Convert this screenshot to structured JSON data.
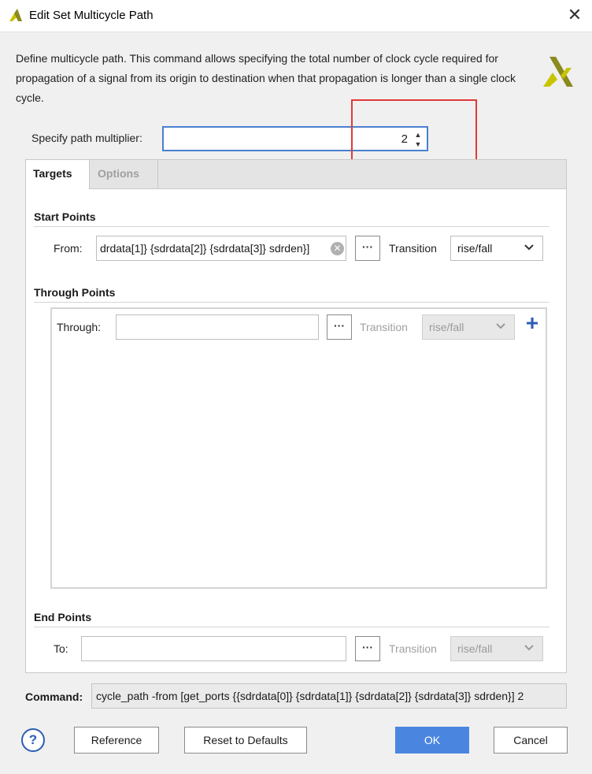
{
  "window": {
    "title": "Edit Set Multicycle Path",
    "close_glyph": "✕"
  },
  "description": "Define multicycle path. This command allows specifying the total number of clock cycle required for propagation of a signal from its origin to destination when that propagation is longer than a single clock cycle.",
  "multiplier": {
    "label": "Specify path multiplier:",
    "value": "2"
  },
  "tabs": [
    {
      "label": "Targets",
      "active": true
    },
    {
      "label": "Options",
      "active": false
    }
  ],
  "start_points": {
    "heading": "Start Points",
    "from_label": "From:",
    "from_value": "drdata[1]} {sdrdata[2]} {sdrdata[3]} sdrden}]",
    "browse_label": "···",
    "transition_label": "Transition",
    "transition_value": "rise/fall"
  },
  "through_points": {
    "heading": "Through Points",
    "through_label": "Through:",
    "through_value": "",
    "browse_label": "···",
    "transition_label": "Transition",
    "transition_value": "rise/fall",
    "add_glyph": "+"
  },
  "end_points": {
    "heading": "End Points",
    "to_label": "To:",
    "to_value": "",
    "browse_label": "···",
    "transition_label": "Transition",
    "transition_value": "rise/fall"
  },
  "command": {
    "label": "Command:",
    "value": "cycle_path -from [get_ports {{sdrdata[0]} {sdrdata[1]} {sdrdata[2]} {sdrdata[3]} sdrden}] 2"
  },
  "buttons": {
    "help": "?",
    "reference": "Reference",
    "reset": "Reset to Defaults",
    "ok": "OK",
    "cancel": "Cancel"
  },
  "colors": {
    "accent": "#4a86e0",
    "highlight_box": "#e03a3a",
    "logo_dark": "#8a8a1e",
    "logo_light": "#c7c400"
  }
}
